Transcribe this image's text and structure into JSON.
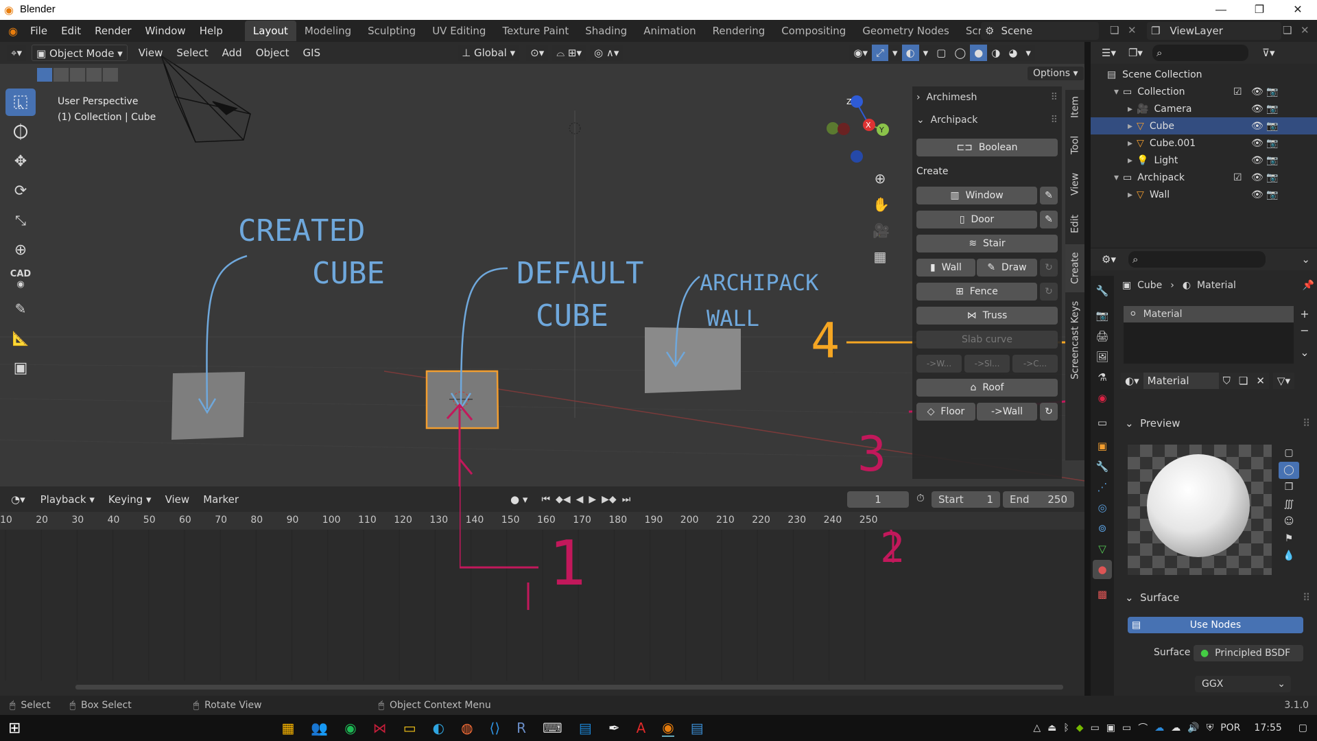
{
  "window": {
    "title": "Blender",
    "minimize": "—",
    "maximize": "❐",
    "close": "✕"
  },
  "menus": [
    "File",
    "Edit",
    "Render",
    "Window",
    "Help"
  ],
  "workspaces": [
    "Layout",
    "Modeling",
    "Sculpting",
    "UV Editing",
    "Texture Paint",
    "Shading",
    "Animation",
    "Rendering",
    "Compositing",
    "Geometry Nodes",
    "Scripting"
  ],
  "active_workspace": "Layout",
  "scene_name": "Scene",
  "view_layer": "ViewLayer",
  "viewport": {
    "mode": "Object Mode",
    "menus": [
      "View",
      "Select",
      "Add",
      "Object",
      "GIS"
    ],
    "orientation": "Global",
    "options": "Options",
    "info_line1": "User Perspective",
    "info_line2": "(1) Collection | Cube",
    "annotations": {
      "created_cube_line1": "CREATED",
      "created_cube_line2": "CUBE",
      "default_cube_line1": "DEFAULT",
      "default_cube_line2": "CUBE",
      "archipack_wall_line1": "ARCHIPACK",
      "archipack_wall_line2": "WALL",
      "num1": "1",
      "num2": "2",
      "num3": "3",
      "num4": "4"
    },
    "gizmo": {
      "x": "X",
      "y": "Y",
      "z": "Z"
    },
    "cad_label": "CAD"
  },
  "npanel": {
    "section1": "Archimesh",
    "section2": "Archipack",
    "boolean": "Boolean",
    "create_label": "Create",
    "window": "Window",
    "door": "Door",
    "stair": "Stair",
    "wall": "Wall",
    "draw": "Draw",
    "fence": "Fence",
    "truss": "Truss",
    "slab_curve": "Slab curve",
    "to_w": "->W...",
    "to_sl": "->Sl...",
    "to_c": "->C...",
    "roof": "Roof",
    "floor": "Floor",
    "to_wall": "->Wall",
    "tabs": [
      "Item",
      "Tool",
      "View",
      "Edit",
      "Create",
      "Screencast Keys"
    ]
  },
  "timeline": {
    "menus": [
      "Playback",
      "Keying",
      "View",
      "Marker"
    ],
    "current_frame": "1",
    "start_label": "Start",
    "start": "1",
    "end_label": "End",
    "end": "250",
    "ticks": [
      "10",
      "20",
      "30",
      "40",
      "50",
      "60",
      "70",
      "80",
      "90",
      "100",
      "110",
      "120",
      "130",
      "140",
      "150",
      "160",
      "170",
      "180",
      "190",
      "200",
      "210",
      "220",
      "230",
      "240",
      "250"
    ]
  },
  "outliner": {
    "scene_collection": "Scene Collection",
    "rows": [
      {
        "label": "Collection",
        "indent": 1,
        "type": "collection"
      },
      {
        "label": "Camera",
        "indent": 2,
        "type": "camera"
      },
      {
        "label": "Cube",
        "indent": 2,
        "type": "mesh",
        "selected": true
      },
      {
        "label": "Cube.001",
        "indent": 2,
        "type": "mesh"
      },
      {
        "label": "Light",
        "indent": 2,
        "type": "light"
      },
      {
        "label": "Archipack",
        "indent": 1,
        "type": "collection"
      },
      {
        "label": "Wall",
        "indent": 2,
        "type": "mesh"
      }
    ]
  },
  "properties": {
    "breadcrumb_object": "Cube",
    "breadcrumb_material": "Material",
    "slot": "Material",
    "material_name": "Material",
    "preview_label": "Preview",
    "surface_section": "Surface",
    "use_nodes": "Use Nodes",
    "surface_label": "Surface",
    "surface_value": "Principled BSDF",
    "distribution": "GGX"
  },
  "statusbar": {
    "select": "Select",
    "box_select": "Box Select",
    "rotate": "Rotate View",
    "context": "Object Context Menu",
    "version": "3.1.0"
  },
  "taskbar": {
    "lang": "POR",
    "time": "17:55"
  },
  "colors": {
    "accent": "#4772b3",
    "annot_blue": "#6fa8dc",
    "annot_magenta": "#c2185b",
    "annot_orange": "#f5a623",
    "selection": "#f29d2f"
  }
}
